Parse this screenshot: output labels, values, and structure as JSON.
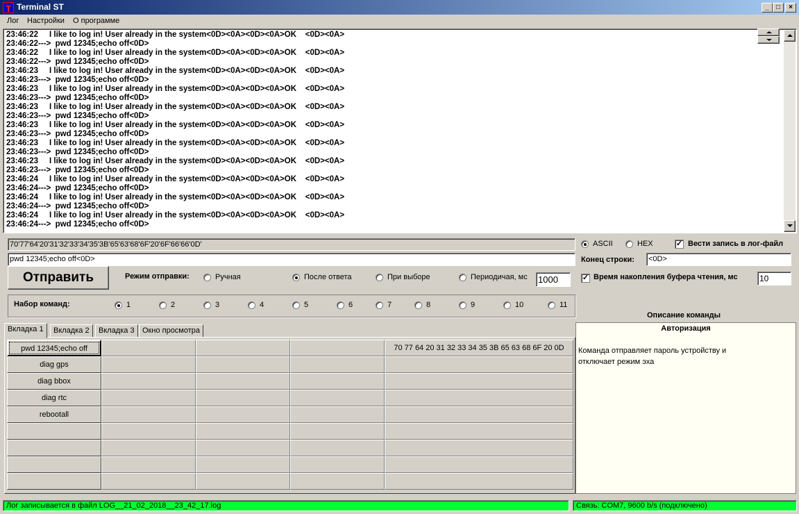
{
  "window": {
    "title": "Terminal ST",
    "app_icon_letter": "T",
    "minimize": "_",
    "maximize": "□",
    "close": "×"
  },
  "menu": [
    "Лог",
    "Настройки",
    "О программе"
  ],
  "log": {
    "lines": [
      "23:46:22     I like to log in! User already in the system<0D><0A><0D><0A>OK    <0D><0A>",
      "23:46:22--->  pwd 12345;echo off<0D>",
      "23:46:22     I like to log in! User already in the system<0D><0A><0D><0A>OK    <0D><0A>",
      "23:46:22--->  pwd 12345;echo off<0D>",
      "23:46:23     I like to log in! User already in the system<0D><0A><0D><0A>OK    <0D><0A>",
      "23:46:23--->  pwd 12345;echo off<0D>",
      "23:46:23     I like to log in! User already in the system<0D><0A><0D><0A>OK    <0D><0A>",
      "23:46:23--->  pwd 12345;echo off<0D>",
      "23:46:23     I like to log in! User already in the system<0D><0A><0D><0A>OK    <0D><0A>",
      "23:46:23--->  pwd 12345;echo off<0D>",
      "23:46:23     I like to log in! User already in the system<0D><0A><0D><0A>OK    <0D><0A>",
      "23:46:23--->  pwd 12345;echo off<0D>",
      "23:46:23     I like to log in! User already in the system<0D><0A><0D><0A>OK    <0D><0A>",
      "23:46:23--->  pwd 12345;echo off<0D>",
      "23:46:23     I like to log in! User already in the system<0D><0A><0D><0A>OK    <0D><0A>",
      "23:46:23--->  pwd 12345;echo off<0D>",
      "23:46:24     I like to log in! User already in the system<0D><0A><0D><0A>OK    <0D><0A>",
      "23:46:24--->  pwd 12345;echo off<0D>",
      "23:46:24     I like to log in! User already in the system<0D><0A><0D><0A>OK    <0D><0A>",
      "23:46:24--->  pwd 12345;echo off<0D>",
      "23:46:24     I like to log in! User already in the system<0D><0A><0D><0A>OK    <0D><0A>",
      "23:46:24--->  pwd 12345;echo off<0D>"
    ]
  },
  "hex_field": "70'77'64'20'31'32'33'34'35'3B'65'63'68'6F'20'6F'66'66'0D'",
  "command_input": "pwd 12345;echo off<0D>",
  "send_button": "Отправить",
  "send_mode": {
    "label": "Режим отправки:",
    "options": [
      "Ручная",
      "После ответа",
      "При выборе",
      "Периодичая, мс"
    ],
    "selected": "После ответа",
    "period_value": "1000"
  },
  "command_set": {
    "label": "Набор команд:",
    "options": [
      "1",
      "2",
      "3",
      "4",
      "5",
      "6",
      "7",
      "8",
      "9",
      "10",
      "11"
    ],
    "selected": "1"
  },
  "encoding": {
    "ascii": "ASCII",
    "hex": "HEX",
    "selected": "ASCII"
  },
  "log_file_checkbox": {
    "label": "Вести запись в лог-файл",
    "checked": true
  },
  "line_end": {
    "label": "Конец строки:",
    "value": "<0D>"
  },
  "buffer_time": {
    "label": "Время накопления буфера чтения, мс",
    "checked": true,
    "value": "10"
  },
  "tabs": [
    "Вкладка 1",
    "Вкладка 2",
    "Вкладка 3",
    "Окно просмотра"
  ],
  "active_tab": "Вкладка 1",
  "commands": [
    {
      "name": "pwd 12345;echo off",
      "hex": "70 77 64 20 31 32 33 34 35 3B 65 63 68 6F 20 0D"
    },
    {
      "name": "diag gps",
      "hex": ""
    },
    {
      "name": "diag bbox",
      "hex": ""
    },
    {
      "name": "diag rtc",
      "hex": ""
    },
    {
      "name": "rebootall",
      "hex": ""
    },
    {
      "name": "",
      "hex": ""
    },
    {
      "name": "",
      "hex": ""
    },
    {
      "name": "",
      "hex": ""
    },
    {
      "name": "",
      "hex": ""
    }
  ],
  "description": {
    "header": "Описание команды",
    "title": "Авторизация",
    "line1": "Команда отправляет пароль устройству и",
    "line2": "отключает режим эха"
  },
  "status": {
    "left": "Лог записывается в файл LOG__21_02_2018__23_42_17.log",
    "right": "Связь: COM7, 9600 b/s (подключено)",
    "color": "#00ff33"
  }
}
